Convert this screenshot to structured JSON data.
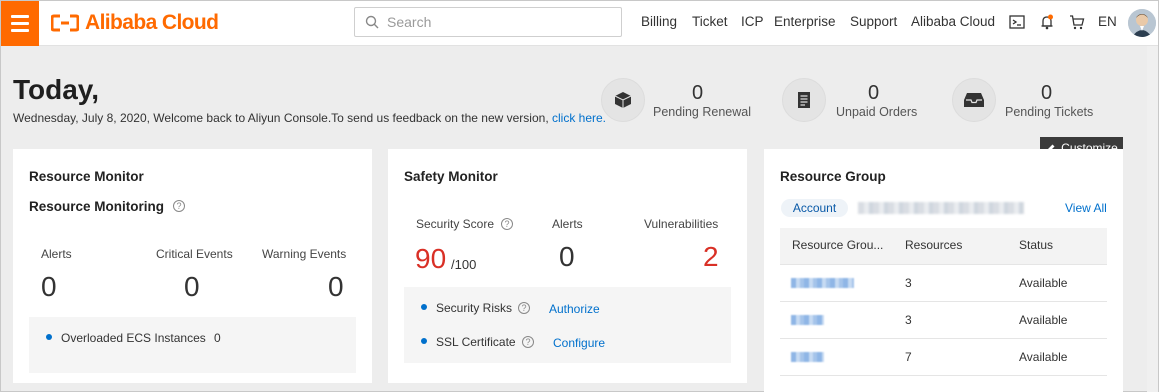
{
  "nav": {
    "brand": "Alibaba Cloud",
    "search_placeholder": "Search",
    "links": [
      "Billing",
      "Ticket",
      "ICP",
      "Enterprise",
      "Support",
      "Alibaba Cloud"
    ],
    "language": "EN",
    "brand_color": "#ff6a00"
  },
  "header": {
    "greeting": "Today,",
    "welcome_text": "Wednesday, July 8, 2020, Welcome back to Aliyun Console.To send us feedback on the new version, ",
    "feedback_link": "click here."
  },
  "stats": [
    {
      "value": "0",
      "label": "Pending Renewal",
      "icon": "box-icon"
    },
    {
      "value": "0",
      "label": "Unpaid Orders",
      "icon": "order-list-icon"
    },
    {
      "value": "0",
      "label": "Pending Tickets",
      "icon": "inbox-tray-icon"
    }
  ],
  "customize_label": "Customize",
  "resource_monitor": {
    "title": "Resource Monitor",
    "subtitle": "Resource Monitoring",
    "metrics": [
      {
        "label": "Alerts",
        "value": "0"
      },
      {
        "label": "Critical Events",
        "value": "0"
      },
      {
        "label": "Warning Events",
        "value": "0"
      }
    ],
    "overloaded_label": "Overloaded ECS Instances",
    "overloaded_value": "0"
  },
  "safety_monitor": {
    "title": "Safety Monitor",
    "score_label": "Security Score",
    "score": "90",
    "score_max": "/100",
    "alerts_label": "Alerts",
    "alerts_value": "0",
    "vuln_label": "Vulnerabilities",
    "vuln_value": "2",
    "risks_label": "Security Risks",
    "risks_action": "Authorize",
    "ssl_label": "SSL Certificate",
    "ssl_action": "Configure",
    "alert_color": "#d93026"
  },
  "resource_group": {
    "title": "Resource Group",
    "account_tag": "Account",
    "view_all": "View All",
    "columns": [
      "Resource Grou...",
      "Resources",
      "Status"
    ],
    "rows": [
      {
        "resources": "3",
        "status": "Available"
      },
      {
        "resources": "3",
        "status": "Available"
      },
      {
        "resources": "7",
        "status": "Available"
      }
    ]
  }
}
